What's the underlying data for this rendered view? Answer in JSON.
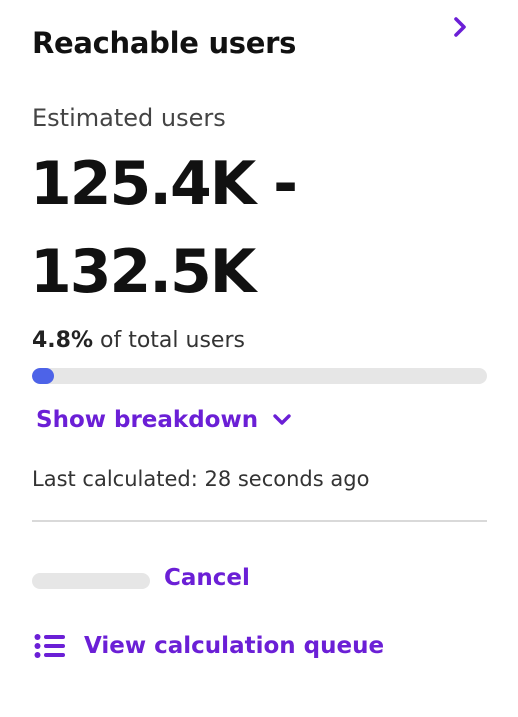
{
  "header": {
    "title": "Reachable users",
    "collapse_icon": "chevron-right-icon"
  },
  "estimate": {
    "label": "Estimated users",
    "range_text": "125.4K - 132.5K",
    "percent_value": "4.8%",
    "percent_suffix": " of total users",
    "progress_fraction": 0.048
  },
  "breakdown": {
    "label": "Show breakdown",
    "icon": "chevron-down-icon"
  },
  "status": {
    "last_calculated": "Last calculated: 28 seconds ago"
  },
  "actions": {
    "cancel_label": "Cancel",
    "queue_label": "View calculation queue",
    "queue_icon": "list-icon"
  },
  "colors": {
    "accent": "#6b1fd6",
    "progress": "#4d63e8",
    "track": "#e6e6e6"
  }
}
